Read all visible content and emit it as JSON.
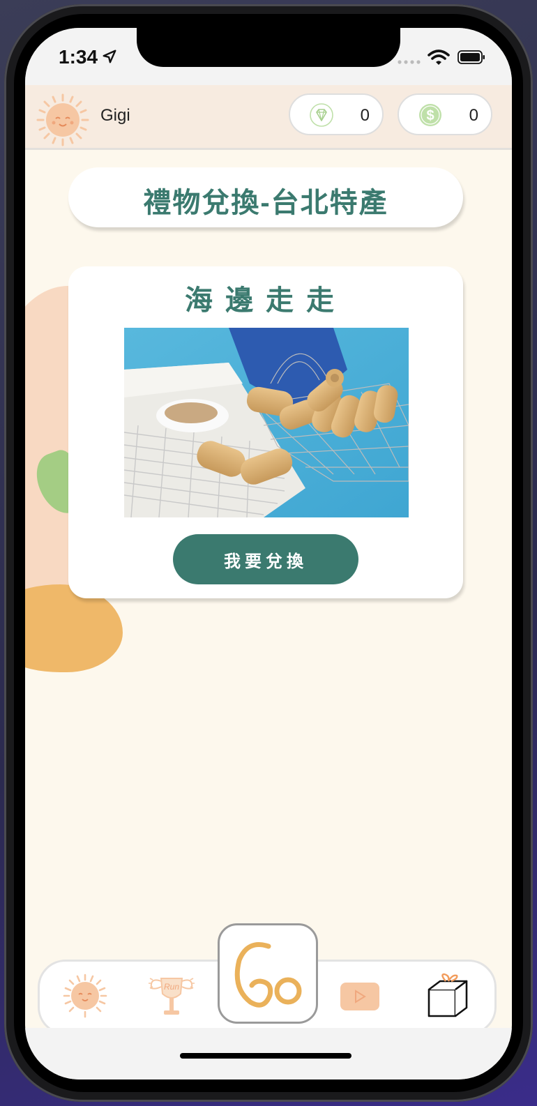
{
  "status_bar": {
    "time": "1:34",
    "icons": [
      "location-arrow-icon",
      "signal-dots-icon",
      "wifi-icon",
      "battery-icon"
    ]
  },
  "header": {
    "username": "Gigi",
    "avatar_icon": "sun-face-icon",
    "diamonds": {
      "icon": "diamond-icon",
      "value": "0"
    },
    "coins": {
      "icon": "dollar-coin-icon",
      "value": "0"
    }
  },
  "page": {
    "title": "禮物兌換-台北特產"
  },
  "product": {
    "name": "海邊走走",
    "image": "product-photo-egg-rolls",
    "button_label": "我要兌換"
  },
  "tabbar": {
    "items": [
      {
        "name": "tab-home",
        "icon": "sun-icon"
      },
      {
        "name": "tab-trophy",
        "icon": "run-trophy-icon",
        "label": "Run"
      },
      {
        "name": "tab-go",
        "icon": "go-logo-icon",
        "label": "Go"
      },
      {
        "name": "tab-video",
        "icon": "play-icon"
      },
      {
        "name": "tab-gift",
        "icon": "gift-box-icon"
      }
    ]
  },
  "colors": {
    "accent_green": "#3b7a6f",
    "background_cream": "#fdf8ed",
    "header_peach": "#f7ebe0",
    "sun_peach": "#f6c7a3",
    "go_orange": "#eab15a"
  }
}
